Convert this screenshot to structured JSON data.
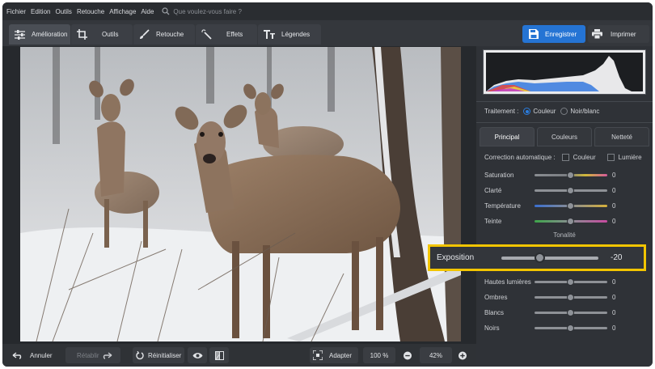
{
  "menu": [
    "Fichier",
    "Edition",
    "Outils",
    "Retouche",
    "Affichage",
    "Aide"
  ],
  "search": {
    "placeholder": "Que voulez-vous faire ?"
  },
  "tabs": [
    {
      "label": "Amélioration",
      "icon": "sliders-icon",
      "active": true
    },
    {
      "label": "Outils",
      "icon": "crop-icon",
      "active": false
    },
    {
      "label": "Retouche",
      "icon": "brush-icon",
      "active": false
    },
    {
      "label": "Effets",
      "icon": "magic-wand-icon",
      "active": false
    },
    {
      "label": "Légendes",
      "icon": "text-icon",
      "active": false
    }
  ],
  "actions": {
    "save": "Enregistrer",
    "print": "Imprimer"
  },
  "bottom": {
    "undo": "Annuler",
    "redo": "Rétablir",
    "reset": "Réinitialiser",
    "fit": "Adapter",
    "zoom100": "100 %",
    "zoom": "42%"
  },
  "panel": {
    "treatment_label": "Traitement :",
    "treatment_options": [
      "Couleur",
      "Noir/blanc"
    ],
    "treatment_selected": "Couleur",
    "tabs": [
      "Principal",
      "Couleurs",
      "Netteté"
    ],
    "active_tab": "Principal",
    "auto_label": "Correction automatique :",
    "auto_options": [
      "Couleur",
      "Lumière"
    ],
    "sliders_top": [
      {
        "label": "Saturation",
        "value": "0"
      },
      {
        "label": "Clarté",
        "value": "0"
      },
      {
        "label": "Température",
        "value": "0"
      },
      {
        "label": "Teinte",
        "value": "0"
      }
    ],
    "tonal_heading": "Tonalité",
    "exposure": {
      "label": "Exposition",
      "value": "-20"
    },
    "sliders_bottom": [
      {
        "label": "Hautes lumières",
        "value": "0"
      },
      {
        "label": "Ombres",
        "value": "0"
      },
      {
        "label": "Blancs",
        "value": "0"
      },
      {
        "label": "Noirs",
        "value": "0"
      }
    ]
  },
  "colors": {
    "accent": "#2574d4",
    "highlight": "#f2c500"
  }
}
